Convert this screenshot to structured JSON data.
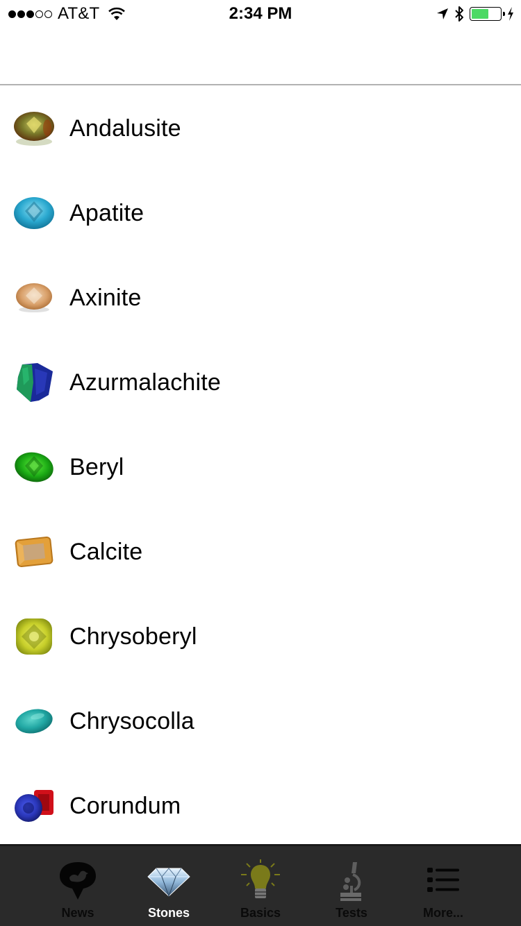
{
  "status_bar": {
    "signal_strength": 3,
    "signal_max": 5,
    "carrier": "AT&T",
    "time": "2:34 PM",
    "battery_level": 0.6,
    "charging": true,
    "colors": {
      "battery": "#4cd964"
    }
  },
  "stones": {
    "items": [
      {
        "name": "Andalusite",
        "icon": "andalusite-gem-icon"
      },
      {
        "name": "Apatite",
        "icon": "apatite-gem-icon"
      },
      {
        "name": "Axinite",
        "icon": "axinite-gem-icon"
      },
      {
        "name": "Azurmalachite",
        "icon": "azurmalachite-gem-icon"
      },
      {
        "name": "Beryl",
        "icon": "beryl-gem-icon"
      },
      {
        "name": "Calcite",
        "icon": "calcite-gem-icon"
      },
      {
        "name": "Chrysoberyl",
        "icon": "chrysoberyl-gem-icon"
      },
      {
        "name": "Chrysocolla",
        "icon": "chrysocolla-gem-icon"
      },
      {
        "name": "Corundum",
        "icon": "corundum-gem-icon"
      }
    ]
  },
  "tab_bar": {
    "active": "Stones",
    "tabs": [
      {
        "label": "News",
        "icon": "bird-speech-bubble-icon"
      },
      {
        "label": "Stones",
        "icon": "diamond-icon"
      },
      {
        "label": "Basics",
        "icon": "lightbulb-icon"
      },
      {
        "label": "Tests",
        "icon": "microscope-icon"
      },
      {
        "label": "More...",
        "icon": "list-icon"
      }
    ]
  }
}
